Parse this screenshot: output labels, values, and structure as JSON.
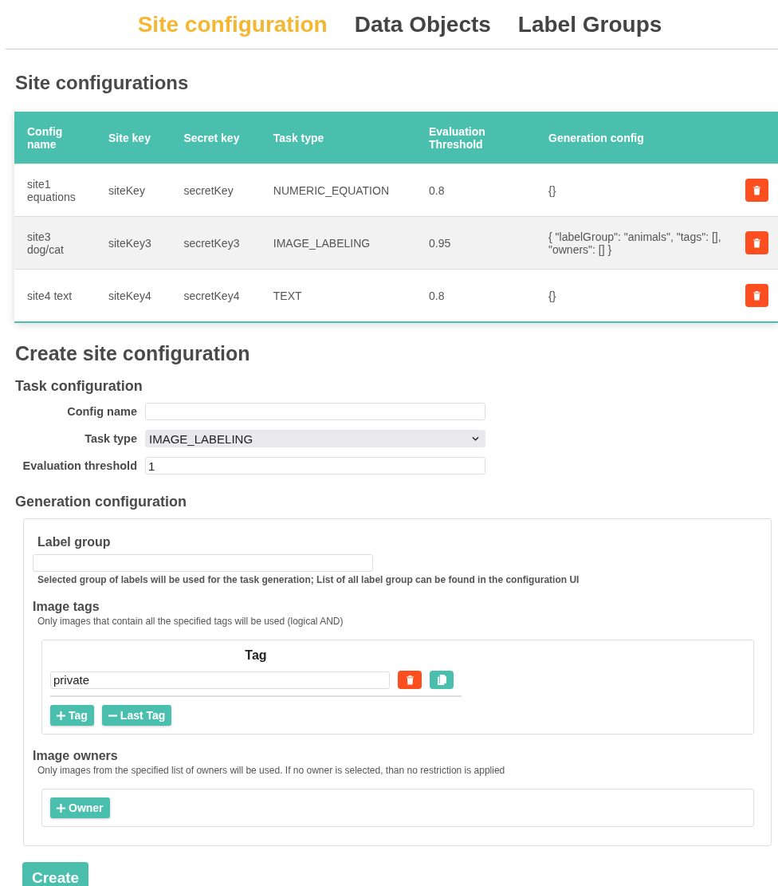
{
  "nav": {
    "tabs": [
      {
        "label": "Site configuration",
        "selected": true
      },
      {
        "label": "Data Objects",
        "selected": false
      },
      {
        "label": "Label Groups",
        "selected": false
      }
    ]
  },
  "site_configurations": {
    "title": "Site configurations",
    "columns": [
      "Config name",
      "Site key",
      "Secret key",
      "Task type",
      "Evaluation Threshold",
      "Generation config"
    ],
    "rows": [
      {
        "cells": [
          "site1 equations",
          "siteKey",
          "secretKey",
          "NUMERIC_EQUATION",
          "0.8",
          "{}"
        ]
      },
      {
        "cells": [
          "site3 dog/cat",
          "siteKey3",
          "secretKey3",
          "IMAGE_LABELING",
          "0.95",
          "{ \"labelGroup\": \"animals\", \"tags\": [], \"owners\": [] }"
        ]
      },
      {
        "cells": [
          "site4 text",
          "siteKey4",
          "secretKey4",
          "TEXT",
          "0.8",
          "{}"
        ]
      }
    ]
  },
  "create": {
    "title": "Create site configuration",
    "task_configuration": {
      "title": "Task configuration",
      "fields": [
        {
          "kind": "text",
          "label": "Config name"
        },
        {
          "kind": "select",
          "label": "Task type",
          "value": "IMAGE_LABELING"
        },
        {
          "kind": "text",
          "label": "Evaluation threshold",
          "value": "1"
        }
      ]
    },
    "generation_configuration": {
      "title": "Generation configuration",
      "label_group": {
        "label": "Label group",
        "help": "Selected group of labels will be used for the task generation; List of all label group can be found in the configuration UI"
      },
      "image_tags": {
        "label": "Image tags",
        "help": "Only images that contain all the specified tags will be used (logical AND)",
        "column": "Tag",
        "tags": [
          {
            "value": "private"
          }
        ],
        "buttons": [
          {
            "kind": "add",
            "label": "Tag"
          },
          {
            "kind": "remove",
            "label": "Last Tag"
          }
        ]
      },
      "image_owners": {
        "label": "Image owners",
        "help": "Only images from the specified list of owners will be used. If no owner is selected, than no restriction is applied",
        "buttons": [
          {
            "kind": "add",
            "label": "Owner"
          }
        ]
      }
    },
    "submit": "Create"
  }
}
